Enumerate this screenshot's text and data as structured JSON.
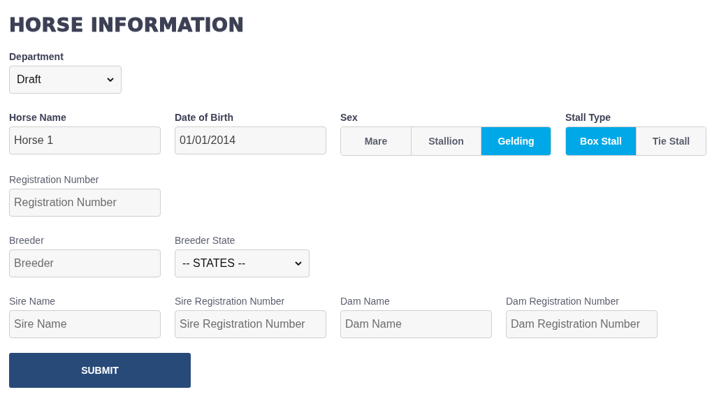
{
  "title": "HORSE INFORMATION",
  "rows": [
    [
      {
        "kind": "select",
        "label": "Department",
        "emphasized": true,
        "value": "Draft"
      }
    ],
    [
      {
        "kind": "input",
        "label": "Horse Name",
        "emphasized": true,
        "value": "Horse 1"
      },
      {
        "kind": "input",
        "label": "Date of Birth",
        "emphasized": true,
        "value": "01/01/2014"
      },
      {
        "kind": "toggle",
        "label": "Sex",
        "emphasized": true,
        "options": [
          {
            "label": "Mare",
            "selected": false
          },
          {
            "label": "Stallion",
            "selected": false
          },
          {
            "label": "Gelding",
            "selected": true
          }
        ]
      },
      {
        "kind": "toggle",
        "label": "Stall  Type",
        "emphasized": true,
        "options": [
          {
            "label": "Box Stall",
            "selected": true
          },
          {
            "label": "Tie Stall",
            "selected": false
          }
        ]
      }
    ],
    [
      {
        "kind": "input",
        "label": "Registration Number",
        "emphasized": false,
        "placeholder": "Registration Number"
      }
    ],
    [
      {
        "kind": "input",
        "label": "Breeder",
        "emphasized": false,
        "placeholder": "Breeder"
      },
      {
        "kind": "select",
        "label": "Breeder State",
        "emphasized": false,
        "value": "-- STATES --"
      }
    ],
    [
      {
        "kind": "input",
        "label": "Sire Name",
        "emphasized": false,
        "placeholder": "Sire Name"
      },
      {
        "kind": "input",
        "label": "Sire Registration Number",
        "emphasized": false,
        "placeholder": "Sire Registration Number"
      },
      {
        "kind": "input",
        "label": "Dam Name",
        "emphasized": false,
        "placeholder": "Dam Name"
      },
      {
        "kind": "input",
        "label": "Dam Registration Number",
        "emphasized": false,
        "placeholder": "Dam Registration Number"
      }
    ]
  ],
  "submit": "SUBMIT"
}
